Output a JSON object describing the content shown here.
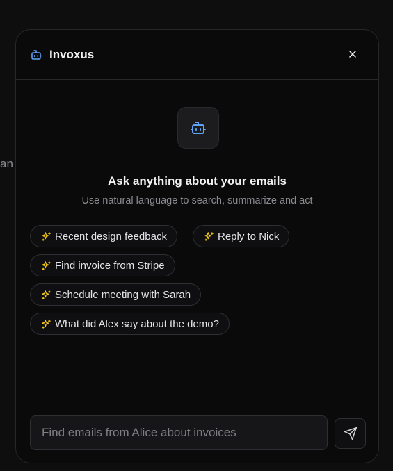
{
  "background": {
    "fragment_text": "an"
  },
  "header": {
    "title": "Invoxus",
    "close_icon": "close-icon",
    "bot_icon": "robot-icon"
  },
  "hero": {
    "icon": "robot-icon",
    "title": "Ask anything about your emails",
    "subtitle": "Use natural language to search, summarize and act"
  },
  "suggestions": [
    {
      "label": "Recent design feedback",
      "icon": "sparkles-icon"
    },
    {
      "label": "Reply to Nick",
      "icon": "sparkles-icon"
    },
    {
      "label": "Find invoice from Stripe",
      "icon": "sparkles-icon"
    },
    {
      "label": "Schedule meeting with Sarah",
      "icon": "sparkles-icon"
    },
    {
      "label": "What did Alex say about the demo?",
      "icon": "sparkles-icon"
    }
  ],
  "composer": {
    "placeholder": "Find emails from Alice about invoices",
    "value": "",
    "send_icon": "send-icon"
  },
  "colors": {
    "accent_blue": "#60a5fa",
    "spark_yellow": "#facc15",
    "panel_bg": "#0a0a0b",
    "border": "#27272a"
  }
}
